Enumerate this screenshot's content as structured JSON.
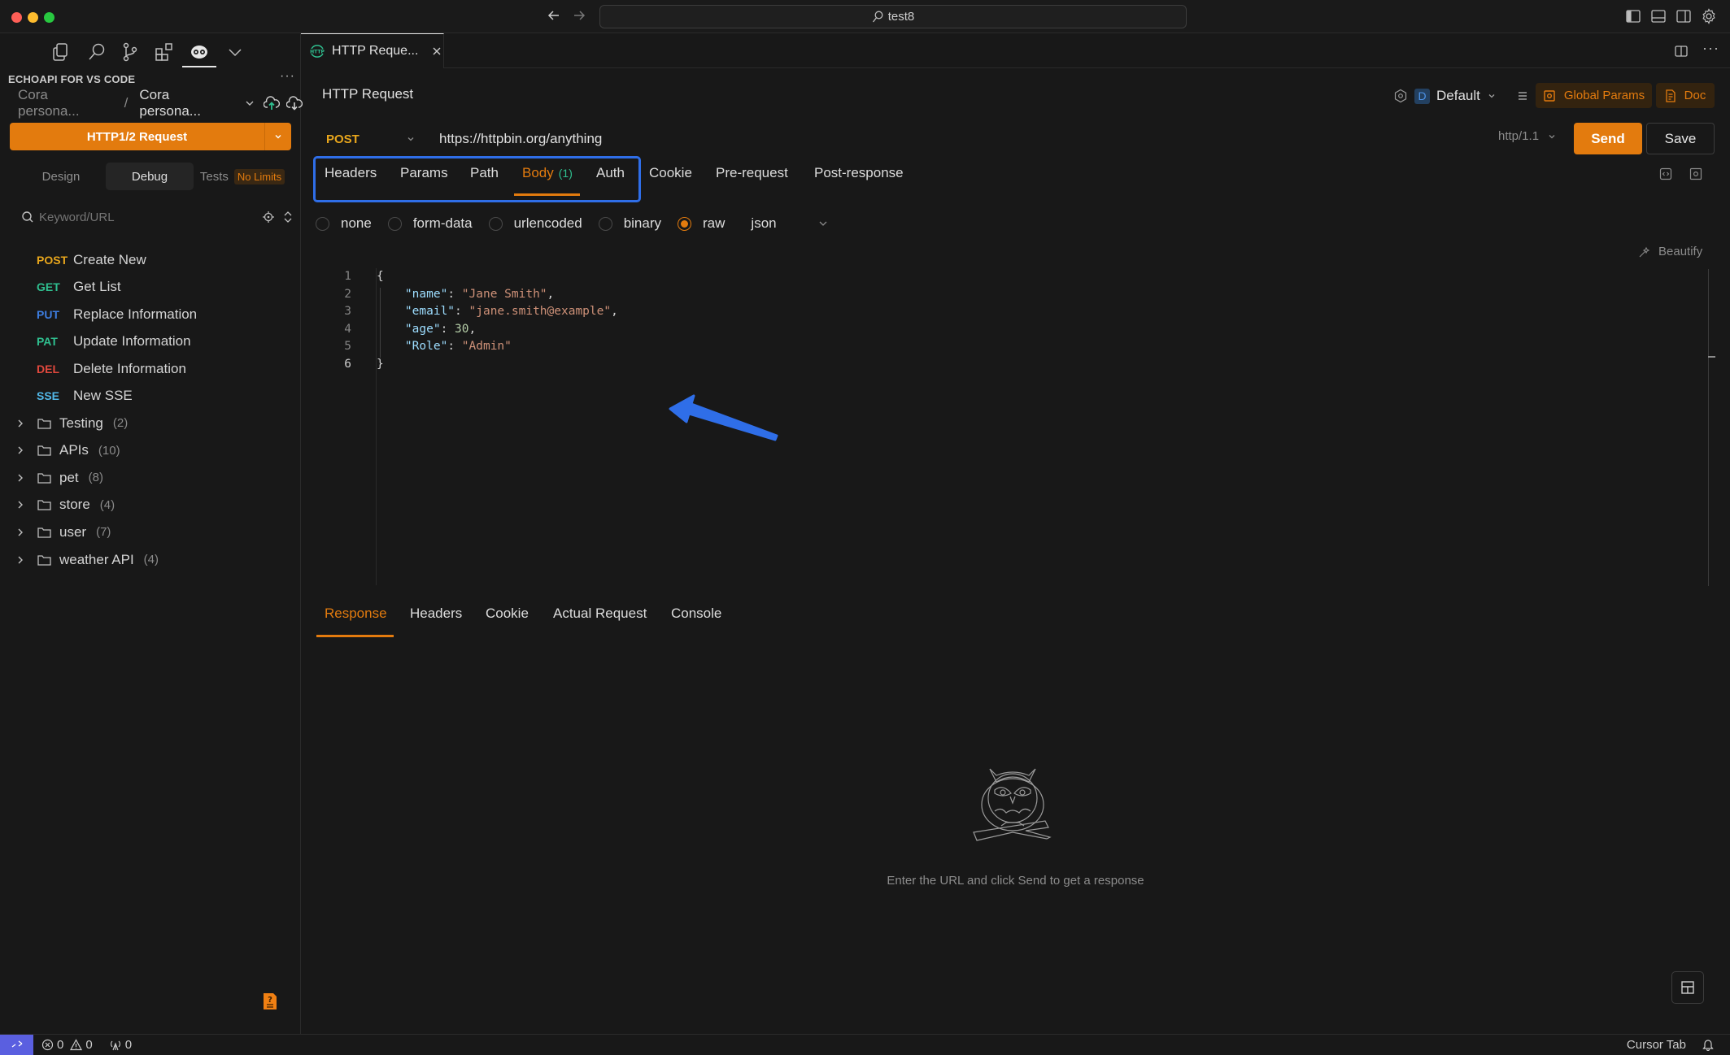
{
  "window": {
    "search_text": "test8",
    "traffic_lights": {
      "close": "#fe5f57",
      "minimize": "#febc2e",
      "maximize": "#28c840"
    }
  },
  "sidebar": {
    "activity_icons": [
      "files-icon",
      "search-icon",
      "source-control-icon",
      "extensions-icon",
      "echoapi-icon",
      "chevron-down-icon"
    ],
    "title": "ECHOAPI FOR VS CODE",
    "more": "···",
    "workspace": {
      "team": "Cora persona...",
      "separator": "/",
      "project": "Cora persona..."
    },
    "new_request_label": "HTTP1/2 Request",
    "modes": [
      {
        "label": "Design",
        "active": false
      },
      {
        "label": "Debug",
        "active": true
      },
      {
        "label": "Tests",
        "badge": "No Limits",
        "active": false
      }
    ],
    "search_placeholder": "Keyword/URL",
    "requests": [
      {
        "method": "POST",
        "color": "#e8a61c",
        "name": "Create New"
      },
      {
        "method": "GET",
        "color": "#2fbf8f",
        "name": "Get List"
      },
      {
        "method": "PUT",
        "color": "#3d7de0",
        "name": "Replace Information"
      },
      {
        "method": "PAT",
        "color": "#2fbf8f",
        "name": "Update Information"
      },
      {
        "method": "DEL",
        "color": "#e0483d",
        "name": "Delete Information"
      },
      {
        "method": "SSE",
        "color": "#52b8e8",
        "name": "New SSE"
      }
    ],
    "folders": [
      {
        "name": "Testing",
        "count": "(2)"
      },
      {
        "name": "APIs",
        "count": "(10)"
      },
      {
        "name": "pet",
        "count": "(8)"
      },
      {
        "name": "store",
        "count": "(4)"
      },
      {
        "name": "user",
        "count": "(7)"
      },
      {
        "name": "weather API",
        "count": "(4)"
      }
    ]
  },
  "editor_tab": {
    "label": "HTTP Reque...",
    "icon": "http-icon"
  },
  "request": {
    "title": "HTTP Request",
    "environment": {
      "badge": "D",
      "name": "Default"
    },
    "global_params_label": "Global Params",
    "doc_label": "Doc",
    "method": "POST",
    "url": "https://httpbin.org/anything",
    "http_version": "http/1.1",
    "send_label": "Send",
    "save_label": "Save",
    "tabs": [
      {
        "label": "Headers"
      },
      {
        "label": "Params"
      },
      {
        "label": "Path"
      },
      {
        "label": "Body",
        "count": "(1)",
        "active": true
      },
      {
        "label": "Auth"
      },
      {
        "label": "Cookie"
      },
      {
        "label": "Pre-request"
      },
      {
        "label": "Post-response"
      }
    ],
    "body_types": [
      {
        "label": "none",
        "selected": false
      },
      {
        "label": "form-data",
        "selected": false
      },
      {
        "label": "urlencoded",
        "selected": false
      },
      {
        "label": "binary",
        "selected": false
      },
      {
        "label": "raw",
        "selected": true
      }
    ],
    "raw_format": "json",
    "beautify_label": "Beautify",
    "body_lines": [
      {
        "num": "1",
        "tokens": [
          [
            "p",
            "{"
          ]
        ]
      },
      {
        "num": "2",
        "tokens": [
          [
            "p",
            "    "
          ],
          [
            "k",
            "\"name\""
          ],
          [
            "p",
            ": "
          ],
          [
            "s",
            "\"Jane Smith\""
          ],
          [
            "p",
            ","
          ]
        ]
      },
      {
        "num": "3",
        "tokens": [
          [
            "p",
            "    "
          ],
          [
            "k",
            "\"email\""
          ],
          [
            "p",
            ": "
          ],
          [
            "s",
            "\"jane.smith@example\""
          ],
          [
            "p",
            ","
          ]
        ]
      },
      {
        "num": "4",
        "tokens": [
          [
            "p",
            "    "
          ],
          [
            "k",
            "\"age\""
          ],
          [
            "p",
            ": "
          ],
          [
            "n",
            "30"
          ],
          [
            "p",
            ","
          ]
        ]
      },
      {
        "num": "5",
        "tokens": [
          [
            "p",
            "    "
          ],
          [
            "k",
            "\"Role\""
          ],
          [
            "p",
            ": "
          ],
          [
            "s",
            "\"Admin\""
          ]
        ]
      },
      {
        "num": "6",
        "tokens": [
          [
            "p",
            "}"
          ]
        ],
        "current": true
      }
    ]
  },
  "response": {
    "tabs": [
      {
        "label": "Response",
        "active": true
      },
      {
        "label": "Headers"
      },
      {
        "label": "Cookie"
      },
      {
        "label": "Actual Request"
      },
      {
        "label": "Console"
      }
    ],
    "empty_message": "Enter the URL and click Send to get a response"
  },
  "statusbar": {
    "errors": "0",
    "warnings": "0",
    "ports": "0",
    "cursor_tab": "Cursor Tab"
  },
  "colors": {
    "accent": "#e37b0e",
    "highlight_annotation": "#2f6ee8",
    "background": "#181818"
  }
}
